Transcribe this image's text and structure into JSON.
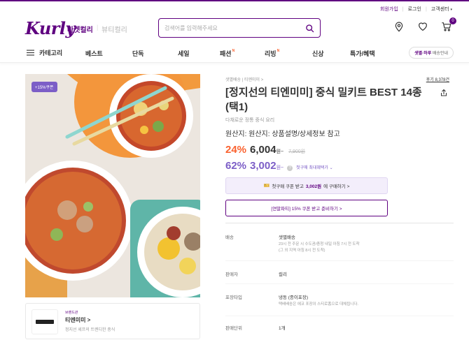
{
  "util_nav": {
    "signup": "회원가입",
    "login": "로그인",
    "customer_center": "고객센터"
  },
  "header": {
    "logo": "Kurly",
    "market_tab": "마켓컬리",
    "beauty_tab": "뷰티컬리",
    "search_placeholder": "검색어를 입력해주세요",
    "cart_count": "0"
  },
  "gnb": {
    "category": "카테고리",
    "items": [
      "베스트",
      "단독",
      "세일",
      "패션",
      "리빙",
      "신상",
      "특가/혜택"
    ],
    "new_badge": "N",
    "delivery_bold": "샛별·하루",
    "delivery_text": "배송안내"
  },
  "product": {
    "coupon_tag": "+15%쿠폰",
    "breadcrumb": "샛별배송 | 티엔미미 >",
    "review_link": "후기 8,378건",
    "title": "[정지선의 티엔미미] 중식 밀키트 BEST 14종 (택1)",
    "subtitle": "다채로운 정통 중식 요리",
    "origin": "원산지: 원산지: 상품설명/상세정보 참고",
    "discount1": "24%",
    "price1": "6,004",
    "unit1": "원~",
    "original_price": "7,900원",
    "discount2": "62%",
    "price2": "3,002",
    "unit2": "원~",
    "first_purchase_max": "첫구매 최대혜택가",
    "coupon_btn_pre": "첫구매 쿠폰 받고",
    "coupon_btn_price": "3,002원",
    "coupon_btn_post": "에 구매하기 >",
    "party_btn": "[연말파티] 15% 쿠폰 받고 준비하기 >"
  },
  "info": [
    {
      "label": "배송",
      "value": "샛별배송",
      "sub": "23시 전 주문 시 수도권/충청 내일 아침 7시 전 도착\n(그 외 지역 아침 8시 전 도착)"
    },
    {
      "label": "판매자",
      "value": "컬리",
      "sub": ""
    },
    {
      "label": "포장타입",
      "value": "냉동 (종이포장)",
      "sub": "택배배송은 에코 포장이 스티로폼으로 대체됩니다."
    },
    {
      "label": "판매단위",
      "value": "1개",
      "sub": ""
    }
  ],
  "brand": {
    "hint": "브랜드관",
    "name": "티엔미미 >",
    "desc": "정지선 셰프의 트렌디한 중식"
  },
  "colors": {
    "brand_purple": "#5f0080",
    "accent_purple": "#7c5ec7",
    "discount_orange": "#fa622f"
  }
}
